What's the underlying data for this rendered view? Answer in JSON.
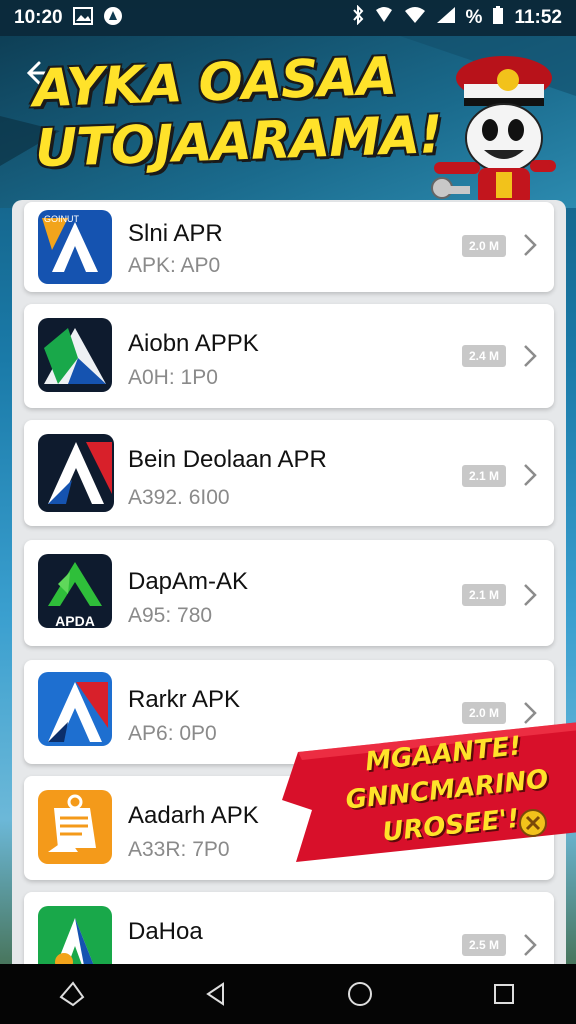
{
  "status_bar": {
    "time_left": "10:20",
    "time_right": "11:52",
    "battery_label": "%"
  },
  "header": {
    "title_line1": "AYKA OASAA",
    "title_line2": "UTOJAARAMA!"
  },
  "apps": [
    {
      "name": "Slni APR",
      "sub": "APK: AP0",
      "badge": "2.0 M",
      "icon": "app-icon-blue-a"
    },
    {
      "name": "Aiobn APPK",
      "sub": "A0H: 1P0",
      "badge": "2.4 M",
      "icon": "app-icon-green-a"
    },
    {
      "name": "Bein Deolaan APR",
      "sub": "A392. 6I00",
      "badge": "2.1 M",
      "icon": "app-icon-red-a"
    },
    {
      "name": "DapAm-AK",
      "sub": "A95: 780",
      "badge": "2.1 M",
      "icon": "app-icon-apda"
    },
    {
      "name": "Rarkr APK",
      "sub": "AP6: 0P0",
      "badge": "2.0 M",
      "icon": "app-icon-blue-red-a"
    },
    {
      "name": "Aadarh APK",
      "sub": "A33R: 7P0",
      "badge": "",
      "icon": "app-icon-orange-doc"
    },
    {
      "name": "DaHoa",
      "sub": "",
      "badge": "2.5 M",
      "icon": "app-icon-green-tri"
    }
  ],
  "apda_label": "APDA",
  "promo": {
    "line1": "MGAANTE!",
    "line2": "GNNCMARINO",
    "line3": "UROSEE'!"
  },
  "colors": {
    "title_yellow": "#ffe22a",
    "promo_red": "#d8102a",
    "header_blue": "#1a6a8c"
  }
}
